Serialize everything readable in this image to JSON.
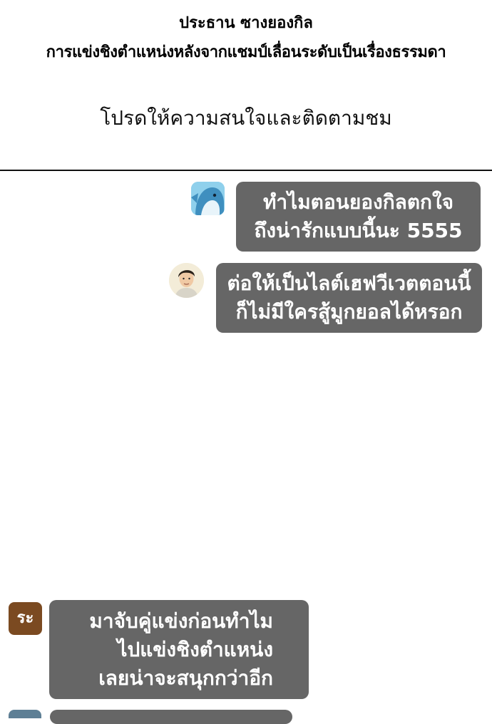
{
  "header": {
    "line1": "ประธาน ซางยองกิล",
    "line2": "การแข่งชิงตำแหน่งหลังจากแชมป์เลื่อนระดับเป็นเรื่องธรรมดา"
  },
  "subtitle": "โปรดให้ความสนใจและติดตามชม",
  "chat": {
    "messages": [
      {
        "avatar": "whale-avatar",
        "lines": [
          "ทำไมตอนยองกิลตกใจ",
          "ถึงน่ารักแบบนี้นะ 5555"
        ]
      },
      {
        "avatar": "man-avatar",
        "lines": [
          "ต่อให้เป็นไลต์เฮฟวีเวตตอนนี้",
          "ก็ไม่มีใครสู้มูกยอลได้หรอก"
        ]
      },
      {
        "avatar": "sa-avatar",
        "avatar_text": "ระ",
        "lines": [
          "มาจับคู่แข่งก่อนทำไม",
          "ไปแข่งชิงตำแหน่ง",
          "เลยน่าจะสนุกกว่าอีก"
        ]
      }
    ]
  },
  "colors": {
    "bubble": "#666666",
    "whale_bg": "#7ec8e6",
    "sa_avatar_bg": "#7b4a21"
  }
}
